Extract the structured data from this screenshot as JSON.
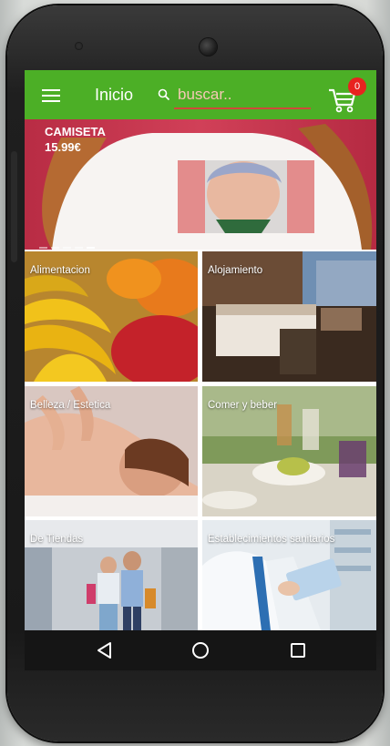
{
  "toolbar": {
    "title": "Inicio",
    "search_placeholder": "buscar..",
    "cart_count": "0",
    "color": "#4caf26"
  },
  "banner": {
    "title": "CAMISETA",
    "price": "15.99€"
  },
  "categories": [
    {
      "label": "Alimentacion"
    },
    {
      "label": "Alojamiento"
    },
    {
      "label": "Belleza / Estetica"
    },
    {
      "label": "Comer y beber"
    },
    {
      "label": "De Tiendas"
    },
    {
      "label": "Establecimientos sanitarios"
    }
  ],
  "icons": {
    "menu": "hamburger-icon",
    "search": "search-icon",
    "cart": "cart-icon",
    "back": "back-triangle-icon",
    "home": "home-circle-icon",
    "recents": "recents-square-icon"
  }
}
